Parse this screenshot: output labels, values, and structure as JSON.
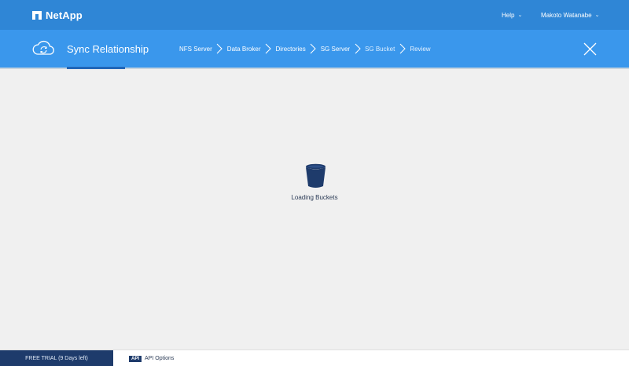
{
  "header": {
    "brand": "NetApp",
    "help_label": "Help",
    "user_label": "Makoto Watanabe"
  },
  "wizard": {
    "title": "Sync Relationship",
    "steps": [
      {
        "label": "NFS Server"
      },
      {
        "label": "Data Broker"
      },
      {
        "label": "Directories"
      },
      {
        "label": "SG Server"
      },
      {
        "label": "SG Bucket"
      },
      {
        "label": "Review"
      }
    ],
    "active_step": "SG Bucket"
  },
  "main": {
    "loading_text": "Loading Buckets"
  },
  "footer": {
    "trial_label": "FREE TRIAL (9 Days left)",
    "api_badge": "API",
    "api_label": "API Options"
  },
  "colors": {
    "topbar": "#2f86d6",
    "wizard_bar": "#3a97ec",
    "accent_dark": "#1e3b6b",
    "underline": "#2166b8"
  },
  "icons": {
    "logo": "netapp-logo-icon",
    "sync": "cloud-sync-icon",
    "close": "close-icon",
    "bucket": "bucket-icon",
    "chevron": "chevron-right-icon"
  }
}
